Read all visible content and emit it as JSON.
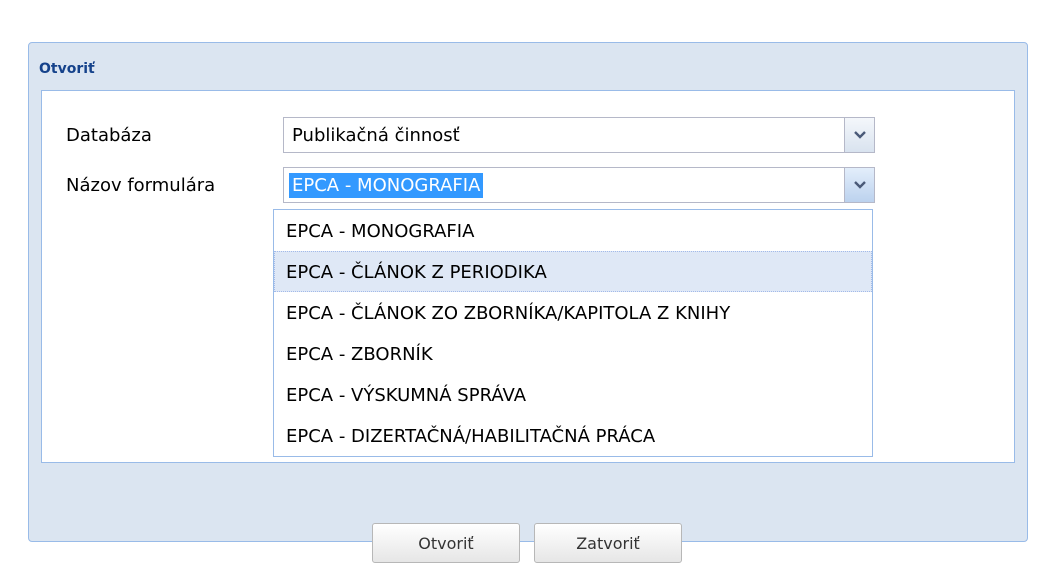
{
  "window": {
    "title": "Otvoriť"
  },
  "form": {
    "database": {
      "label": "Databáza",
      "value": "Publikačná činnosť"
    },
    "form_name": {
      "label": "Názov formulára",
      "value": "EPCA - MONOGRAFIA"
    }
  },
  "dropdown": {
    "options": [
      "EPCA - MONOGRAFIA",
      "EPCA - ČLÁNOK Z PERIODIKA",
      "EPCA - ČLÁNOK ZO ZBORNÍKA/KAPITOLA Z KNIHY",
      "EPCA - ZBORNÍK",
      "EPCA - VÝSKUMNÁ SPRÁVA",
      "EPCA - DIZERTAČNÁ/HABILITAČNÁ PRÁCA"
    ],
    "hovered_index": 1
  },
  "buttons": {
    "open": "Otvoriť",
    "close": "Zatvoriť"
  },
  "colors": {
    "title": "#15428b",
    "selection": "#3399ff",
    "panel_border": "#99bbe8",
    "window_bg": "#dbe5f1"
  }
}
